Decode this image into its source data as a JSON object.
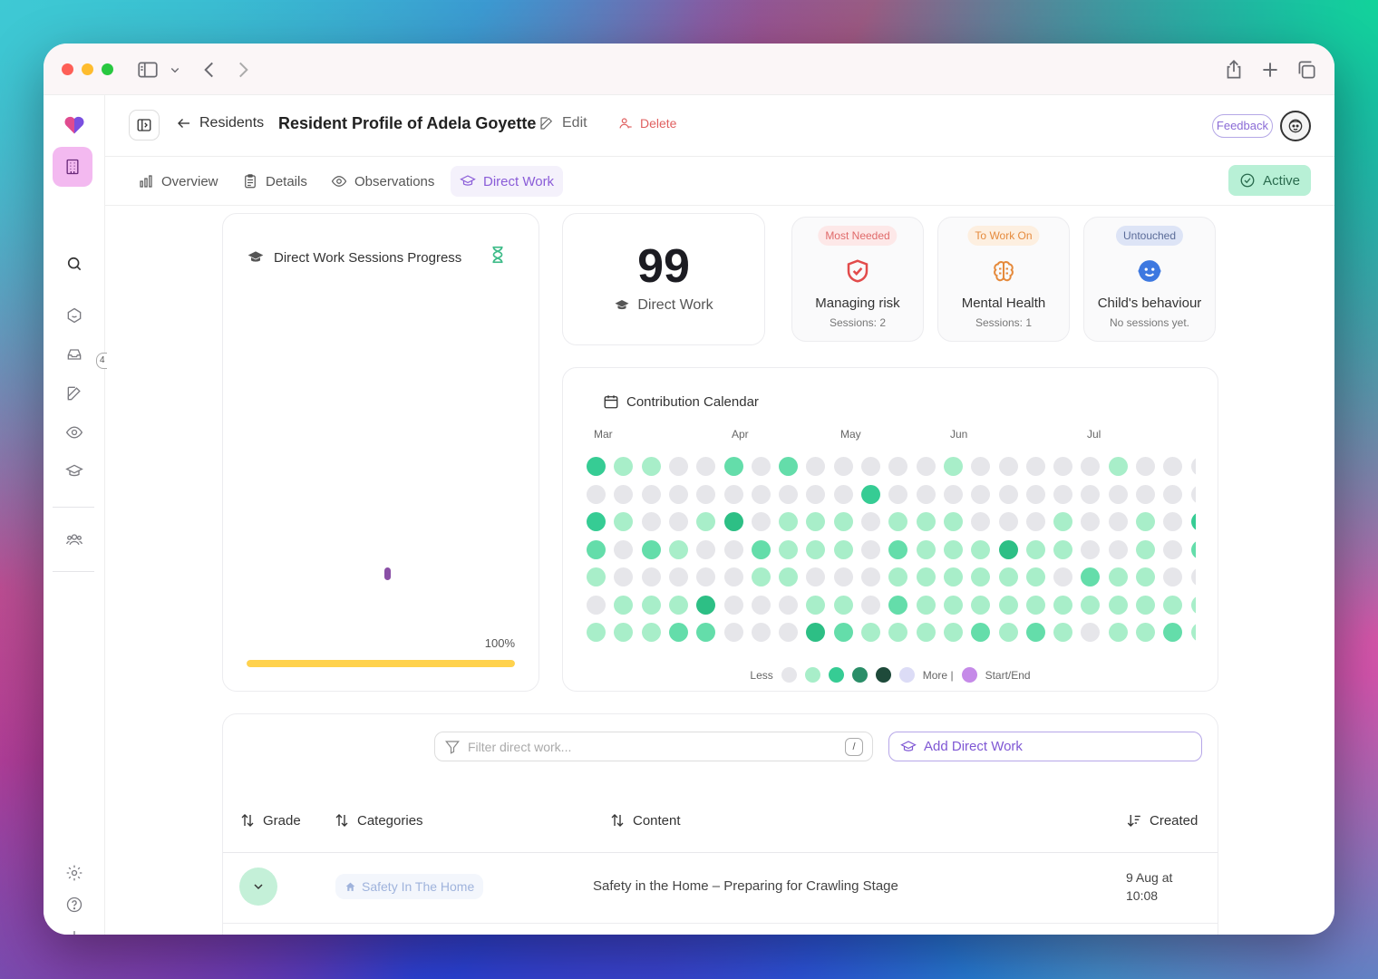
{
  "header": {
    "back_label": "Residents",
    "title": "Resident Profile of Adela Goyette",
    "edit_label": "Edit",
    "delete_label": "Delete",
    "feedback_label": "Feedback"
  },
  "rail": {
    "badge": "4"
  },
  "tabs": [
    {
      "label": "Overview",
      "icon": "bar-chart-icon"
    },
    {
      "label": "Details",
      "icon": "clipboard-icon"
    },
    {
      "label": "Observations",
      "icon": "eye-icon"
    },
    {
      "label": "Direct Work",
      "icon": "graduation-cap-icon"
    }
  ],
  "status": {
    "label": "Active"
  },
  "progress_card": {
    "title": "Direct Work Sessions Progress",
    "percent_label": "100%",
    "progress": 1.0
  },
  "stat": {
    "value": "99",
    "label": "Direct Work"
  },
  "categories": [
    {
      "badge": "Most Needed",
      "title": "Managing risk",
      "sub": "Sessions: 2",
      "badge_bg": "#fde8e8",
      "badge_fg": "#e06a6a",
      "icon": "shield-check-icon"
    },
    {
      "badge": "To Work On",
      "title": "Mental Health",
      "sub": "Sessions: 1",
      "badge_bg": "#fdefe0",
      "badge_fg": "#e58a3c",
      "icon": "brain-icon"
    },
    {
      "badge": "Untouched",
      "title": "Child's behaviour",
      "sub": "No sessions yet.",
      "badge_bg": "#dde4f6",
      "badge_fg": "#5a6b98",
      "icon": "smiley-face-icon"
    }
  ],
  "calendar": {
    "title": "Contribution Calendar",
    "months": [
      "Mar",
      "Apr",
      "May",
      "Jun",
      "Jul"
    ],
    "rows": [
      "3110020200000100000100000",
      "0000000000300000000000000",
      "3100140111011100010010300",
      "2021002111021114110010200",
      "1000001100011111102110000",
      "0111400011021111111111130",
      "1112200042111121210112110"
    ],
    "levels": [
      "#e6e6ea",
      "#a8eec9",
      "#64ddaa",
      "#36cc94",
      "#2dbf85"
    ],
    "legend_less": "Less",
    "legend_more": "More |",
    "legend_startend": "Start/End",
    "legend_colors": [
      "#e6e6ea",
      "#a8eec9",
      "#36cc94",
      "#2a8e68",
      "#1e4a3a",
      "#dcdcf6",
      "#c58ae8"
    ]
  },
  "table": {
    "filter_placeholder": "Filter direct work...",
    "filter_shortcut": "/",
    "add_label": "Add Direct Work",
    "columns": {
      "grade": "Grade",
      "categories": "Categories",
      "content": "Content",
      "created": "Created"
    },
    "rows": [
      {
        "category": "Safety In The Home",
        "content": "Safety in the Home – Preparing for Crawling Stage",
        "created_line1": "9 Aug at",
        "created_line2": "10:08"
      }
    ]
  }
}
